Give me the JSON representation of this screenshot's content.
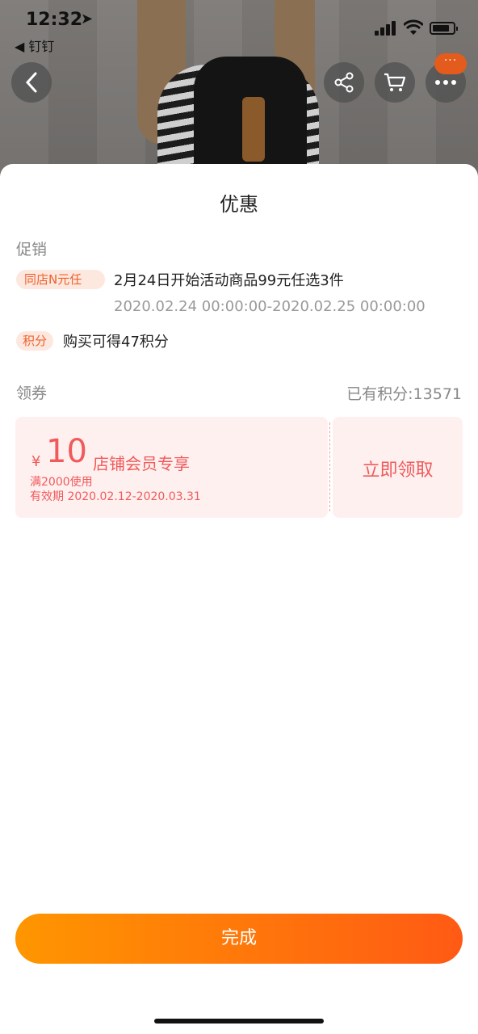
{
  "status_bar": {
    "time": "12:32",
    "back_app": "◀ 钉钉"
  },
  "top_actions": {
    "badge": "···"
  },
  "sheet": {
    "title": "优惠",
    "promo_section": {
      "label": "促销",
      "items": [
        {
          "tag": "同店N元任",
          "text": "2月24日开始活动商品99元任选3件",
          "time": "2020.02.24 00:00:00-2020.02.25 00:00:00"
        },
        {
          "tag": "积分",
          "text": "购买可得47积分"
        }
      ]
    },
    "coupon_section": {
      "label": "领券",
      "points_total": "已有积分:13571",
      "coupon": {
        "currency": "¥",
        "amount": "10",
        "name": "店铺会员专享",
        "condition": "满2000使用",
        "validity": "有效期 2020.02.12-2020.03.31",
        "claim": "立即领取"
      }
    },
    "done_button": "完成"
  },
  "colors": {
    "accent_orange": "#ff9600",
    "accent_red_orange": "#ff5a14",
    "coupon_red": "#f05a5a",
    "coupon_bg": "#fff0f0",
    "tag_bg": "#fde8e0"
  }
}
